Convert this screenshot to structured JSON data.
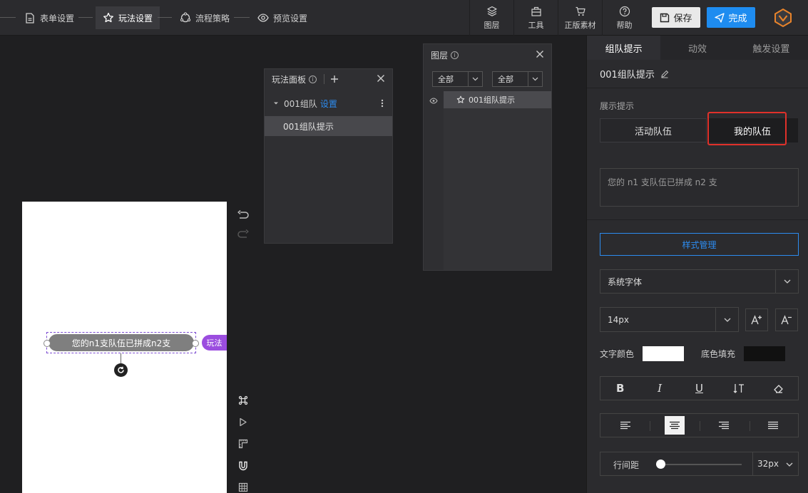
{
  "steps": [
    {
      "label": "表单设置",
      "icon": "document-icon"
    },
    {
      "label": "玩法设置",
      "icon": "star-icon"
    },
    {
      "label": "流程策略",
      "icon": "flow-icon"
    },
    {
      "label": "预览设置",
      "icon": "eye-icon"
    }
  ],
  "tools": [
    {
      "label": "图层",
      "icon": "layers-icon"
    },
    {
      "label": "工具",
      "icon": "toolbox-icon"
    },
    {
      "label": "正版素材",
      "icon": "cart-icon"
    },
    {
      "label": "帮助",
      "icon": "help-icon"
    }
  ],
  "actions": {
    "save": "保存",
    "done": "完成"
  },
  "canvas": {
    "element_text": "您的n1支队伍已拼成n2支",
    "tag": "玩法"
  },
  "play_panel": {
    "title": "玩法面板",
    "group_name": "001组队",
    "group_link": "设置",
    "child": "001组队提示"
  },
  "layer_panel": {
    "title": "图层",
    "filter1": "全部",
    "filter2": "全部",
    "item": "001组队提示"
  },
  "props": {
    "tabs": [
      "组队提示",
      "动效",
      "触发设置"
    ],
    "title": "001组队提示",
    "section_label": "展示提示",
    "segments": [
      "活动队伍",
      "我的队伍"
    ],
    "text_value": "您的  n1  支队伍已拼成  n2  支",
    "style_button": "样式管理",
    "font_family": "系统字体",
    "font_size": "14px",
    "text_color_label": "文字颜色",
    "bg_fill_label": "底色填充",
    "text_color": "#ffffff",
    "bg_color": "#111111",
    "line_height_label": "行间距",
    "line_height_value": "32px",
    "accent": "#2d8cf0",
    "highlight": "#e0312a"
  }
}
